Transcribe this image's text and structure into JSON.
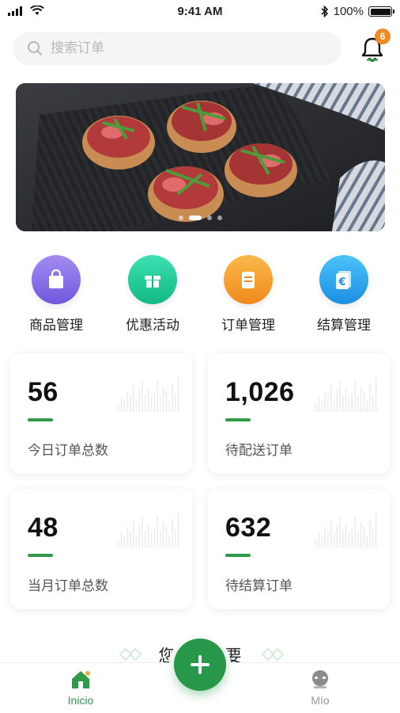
{
  "status_bar": {
    "time": "9:41 AM",
    "battery": "100%"
  },
  "search": {
    "placeholder": "搜索订单"
  },
  "notifications": {
    "count": "6"
  },
  "banner": {
    "slide_count": 4,
    "active_slide": 1
  },
  "quick_menu": [
    {
      "label": "商品管理",
      "icon": "shopping-bag-icon",
      "color": "#8a73e8"
    },
    {
      "label": "优惠活动",
      "icon": "gift-icon",
      "color": "#1fcf9a"
    },
    {
      "label": "订单管理",
      "icon": "clipboard-icon",
      "color": "#f5a02a"
    },
    {
      "label": "结算管理",
      "icon": "euro-bill-icon",
      "color": "#2aa6ee"
    }
  ],
  "stats": [
    {
      "value": "56",
      "label": "今日订单总数"
    },
    {
      "value": "1,026",
      "label": "待配送订单"
    },
    {
      "value": "48",
      "label": "当月订单总数"
    },
    {
      "value": "632",
      "label": "待结算订单"
    }
  ],
  "section": {
    "title": "您可能需要"
  },
  "tabbar": {
    "home_label": "Inicio",
    "mine_label": "Mío",
    "active": "home"
  },
  "colors": {
    "accent_green": "#27974a",
    "badge_orange": "#f08a24"
  }
}
